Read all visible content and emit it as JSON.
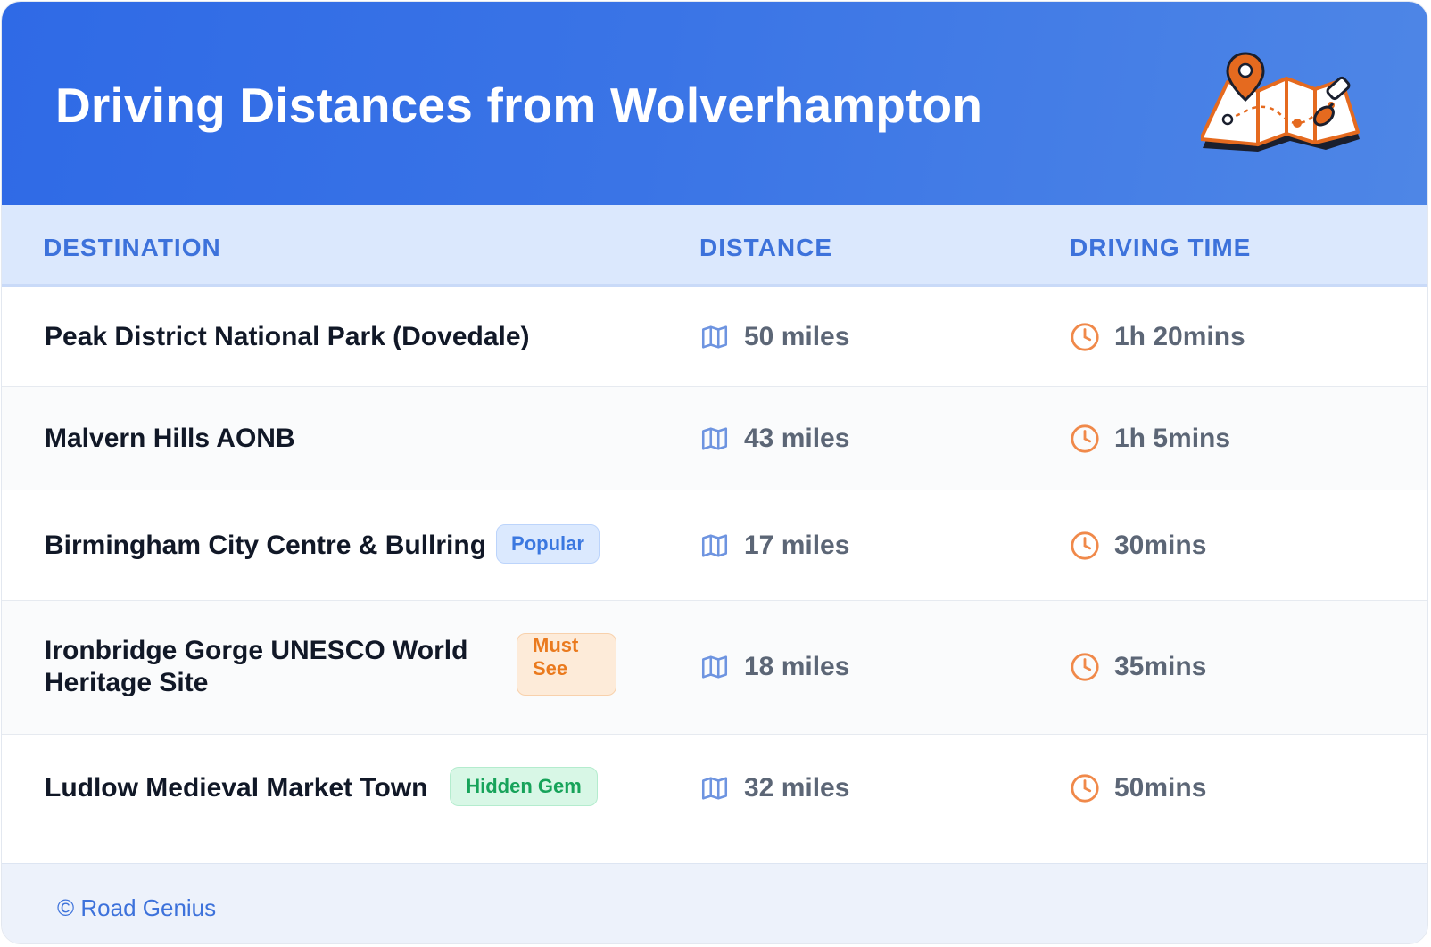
{
  "header": {
    "title": "Driving Distances from Wolverhampton",
    "illustration_icon": "folded-map-with-pins-icon"
  },
  "columns": {
    "destination": "DESTINATION",
    "distance": "DISTANCE",
    "driving_time": "DRIVING TIME"
  },
  "rows": [
    {
      "destination": "Peak District National Park (Dovedale)",
      "badge": "",
      "distance": "50 miles",
      "time": "1h 20mins"
    },
    {
      "destination": "Malvern Hills AONB",
      "badge": "",
      "distance": "43 miles",
      "time": "1h 5mins"
    },
    {
      "destination": "Birmingham City Centre & Bullring",
      "badge": "Popular",
      "distance": "17 miles",
      "time": "30mins"
    },
    {
      "destination_line1": "Ironbridge Gorge UNESCO World",
      "destination_line2": "Heritage Site",
      "badge_line1": "Must",
      "badge_line2": "See",
      "distance": "18 miles",
      "time": "35mins"
    },
    {
      "destination": "Ludlow Medieval Market Town",
      "badge": "Hidden Gem",
      "distance": "32 miles",
      "time": "50mins"
    }
  ],
  "icons": {
    "distance_icon": "map-icon",
    "time_icon": "clock-icon"
  },
  "footer": {
    "credit": "© Road Genius"
  },
  "colors": {
    "header_gradient_start": "#2f6ae6",
    "header_gradient_end": "#4e86e6",
    "column_header_text": "#3d72db",
    "badge_popular": "#3b78e0",
    "badge_must_see": "#ea7a1e",
    "badge_hidden_gem": "#17a35a",
    "clock_icon": "#f0894a",
    "map_icon": "#6e94e0"
  }
}
